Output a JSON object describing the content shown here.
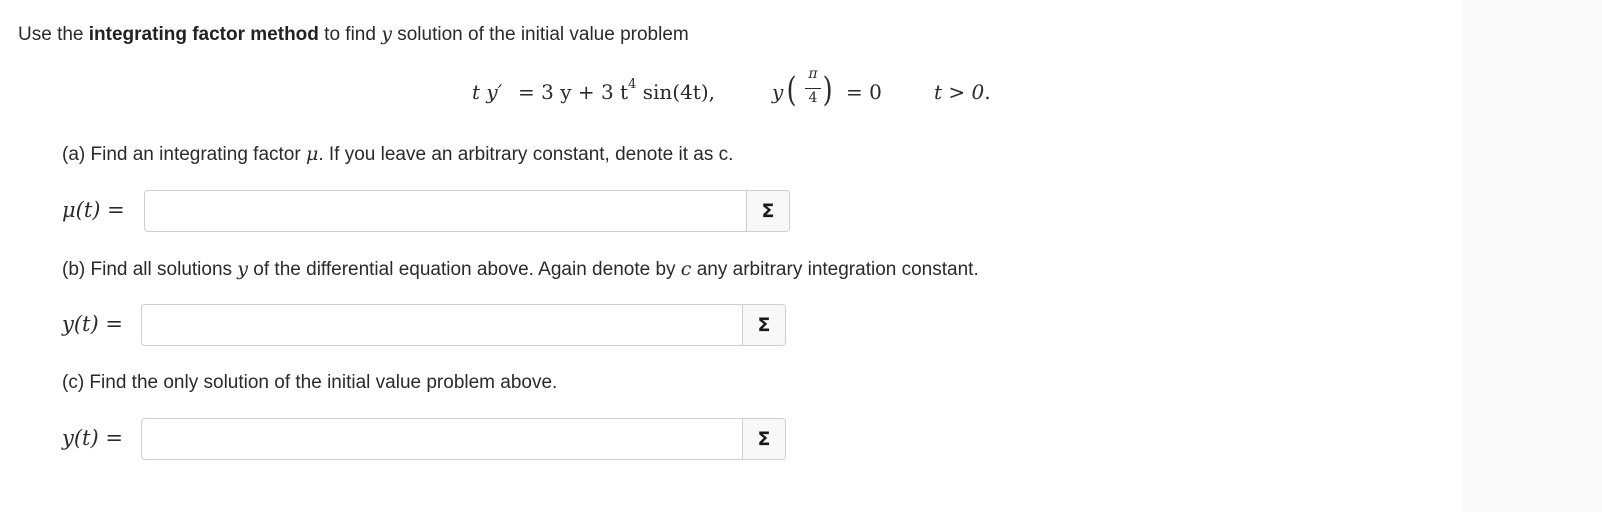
{
  "intro": {
    "prefix": "Use the ",
    "method": "integrating factor method",
    "middle": " to find ",
    "var": "y",
    "suffix": " solution of the initial value problem"
  },
  "equation": {
    "ode_lhs": "t y′",
    "ode_rhs": "= 3 y + 3 t",
    "exp": "4",
    "ode_tail": " sin(4t),",
    "ic_y": "y",
    "ic_num": "π",
    "ic_den": "4",
    "ic_rhs": "= 0",
    "domain": "t > 0."
  },
  "parts": {
    "a": {
      "prefix": "(a) Find an integrating factor ",
      "mu": "μ",
      "suffix": ". If you leave an arbitrary constant, denote it as ",
      "c": "c",
      "end": ".",
      "field_label": "μ(t) =",
      "input_value": "",
      "button_label": "Σ"
    },
    "b": {
      "prefix": "(b) Find all solutions ",
      "y": "y",
      "middle": " of the differential equation above. Again denote by ",
      "c": "c",
      "suffix": " any arbitrary integration constant.",
      "field_label": "y(t) =",
      "input_value": "",
      "button_label": "Σ"
    },
    "c": {
      "text": "(c) Find the only solution of the initial value problem above.",
      "field_label": "y(t) =",
      "input_value": "",
      "button_label": "Σ"
    }
  }
}
